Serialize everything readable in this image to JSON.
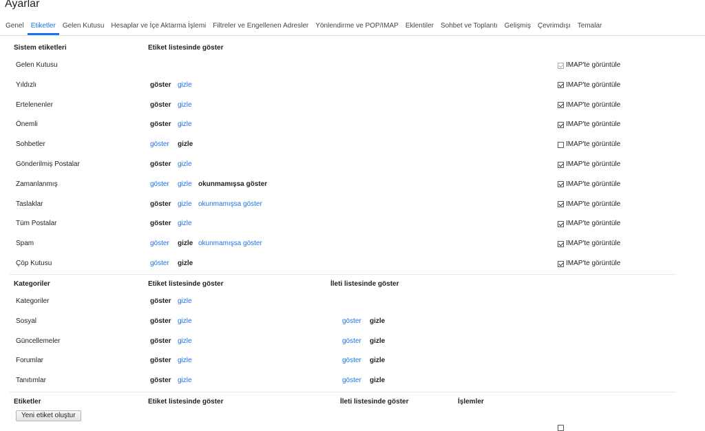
{
  "page_title": "Ayarlar",
  "tabs": [
    {
      "label": "Genel",
      "active": false
    },
    {
      "label": "Etiketler",
      "active": true
    },
    {
      "label": "Gelen Kutusu",
      "active": false
    },
    {
      "label": "Hesaplar ve İçe Aktarma İşlemi",
      "active": false
    },
    {
      "label": "Filtreler ve Engellenen Adresler",
      "active": false
    },
    {
      "label": "Yönlendirme ve POP/IMAP",
      "active": false
    },
    {
      "label": "Eklentiler",
      "active": false
    },
    {
      "label": "Sohbet ve Toplantı",
      "active": false
    },
    {
      "label": "Gelişmiş",
      "active": false
    },
    {
      "label": "Çevrimdışı",
      "active": false
    },
    {
      "label": "Temalar",
      "active": false
    }
  ],
  "system": {
    "header": "Sistem etiketleri",
    "col_label_list": "Etiket listesinde göster",
    "rows": [
      {
        "name": "Gelen Kutusu",
        "actions": [],
        "imap_label": "IMAP'te görüntüle",
        "imap_checked": true,
        "imap_disabled": true
      },
      {
        "name": "Yıldızlı",
        "actions": [
          {
            "text": "göster",
            "style": "bold"
          },
          {
            "text": "gizle",
            "style": "link"
          }
        ],
        "imap_label": "IMAP'te görüntüle",
        "imap_checked": true,
        "imap_disabled": false
      },
      {
        "name": "Ertelenenler",
        "actions": [
          {
            "text": "göster",
            "style": "bold"
          },
          {
            "text": "gizle",
            "style": "link"
          }
        ],
        "imap_label": "IMAP'te görüntüle",
        "imap_checked": true,
        "imap_disabled": false
      },
      {
        "name": "Önemli",
        "actions": [
          {
            "text": "göster",
            "style": "bold"
          },
          {
            "text": "gizle",
            "style": "link"
          }
        ],
        "imap_label": "IMAP'te görüntüle",
        "imap_checked": true,
        "imap_disabled": false
      },
      {
        "name": "Sohbetler",
        "actions": [
          {
            "text": "göster",
            "style": "link"
          },
          {
            "text": "gizle",
            "style": "bold"
          }
        ],
        "imap_label": "IMAP'te görüntüle",
        "imap_checked": false,
        "imap_disabled": false
      },
      {
        "name": "Gönderilmiş Postalar",
        "actions": [
          {
            "text": "göster",
            "style": "bold"
          },
          {
            "text": "gizle",
            "style": "link"
          }
        ],
        "imap_label": "IMAP'te görüntüle",
        "imap_checked": true,
        "imap_disabled": false
      },
      {
        "name": "Zamanlanmış",
        "actions": [
          {
            "text": "göster",
            "style": "link"
          },
          {
            "text": "gizle",
            "style": "link"
          },
          {
            "text": "okunmamışsa göster",
            "style": "bold"
          }
        ],
        "imap_label": "IMAP'te görüntüle",
        "imap_checked": true,
        "imap_disabled": false
      },
      {
        "name": "Taslaklar",
        "actions": [
          {
            "text": "göster",
            "style": "bold"
          },
          {
            "text": "gizle",
            "style": "link"
          },
          {
            "text": "okunmamışsa göster",
            "style": "link"
          }
        ],
        "imap_label": "IMAP'te görüntüle",
        "imap_checked": true,
        "imap_disabled": false
      },
      {
        "name": "Tüm Postalar",
        "actions": [
          {
            "text": "göster",
            "style": "bold"
          },
          {
            "text": "gizle",
            "style": "link"
          }
        ],
        "imap_label": "IMAP'te görüntüle",
        "imap_checked": true,
        "imap_disabled": false
      },
      {
        "name": "Spam",
        "actions": [
          {
            "text": "göster",
            "style": "link"
          },
          {
            "text": "gizle",
            "style": "bold"
          },
          {
            "text": "okunmamışsa göster",
            "style": "link"
          }
        ],
        "imap_label": "IMAP'te görüntüle",
        "imap_checked": true,
        "imap_disabled": false
      },
      {
        "name": "Çöp Kutusu",
        "actions": [
          {
            "text": "göster",
            "style": "link"
          },
          {
            "text": "gizle",
            "style": "bold"
          }
        ],
        "imap_label": "IMAP'te görüntüle",
        "imap_checked": true,
        "imap_disabled": false
      }
    ]
  },
  "categories": {
    "header": "Kategoriler",
    "col_label_list": "Etiket listesinde göster",
    "col_message_list": "İleti listesinde göster",
    "rows": [
      {
        "name": "Kategoriler",
        "actions": [
          {
            "text": "göster",
            "style": "bold"
          },
          {
            "text": "gizle",
            "style": "link"
          }
        ],
        "msg_actions": []
      },
      {
        "name": "Sosyal",
        "actions": [
          {
            "text": "göster",
            "style": "bold"
          },
          {
            "text": "gizle",
            "style": "link"
          }
        ],
        "msg_actions": [
          {
            "text": "göster",
            "style": "link"
          },
          {
            "text": "gizle",
            "style": "bold"
          }
        ]
      },
      {
        "name": "Güncellemeler",
        "actions": [
          {
            "text": "göster",
            "style": "bold"
          },
          {
            "text": "gizle",
            "style": "link"
          }
        ],
        "msg_actions": [
          {
            "text": "göster",
            "style": "link"
          },
          {
            "text": "gizle",
            "style": "bold"
          }
        ]
      },
      {
        "name": "Forumlar",
        "actions": [
          {
            "text": "göster",
            "style": "bold"
          },
          {
            "text": "gizle",
            "style": "link"
          }
        ],
        "msg_actions": [
          {
            "text": "göster",
            "style": "link"
          },
          {
            "text": "gizle",
            "style": "bold"
          }
        ]
      },
      {
        "name": "Tanıtımlar",
        "actions": [
          {
            "text": "göster",
            "style": "bold"
          },
          {
            "text": "gizle",
            "style": "link"
          }
        ],
        "msg_actions": [
          {
            "text": "göster",
            "style": "link"
          },
          {
            "text": "gizle",
            "style": "bold"
          }
        ]
      }
    ]
  },
  "labels": {
    "header": "Etiketler",
    "col_label_list": "Etiket listesinde göster",
    "col_message_list": "İleti listesinde göster",
    "col_actions": "İşlemler",
    "create_button": "Yeni etiket oluştur"
  },
  "colors": {
    "link": "#1a73e8",
    "active_tab": "#1a73e8"
  }
}
